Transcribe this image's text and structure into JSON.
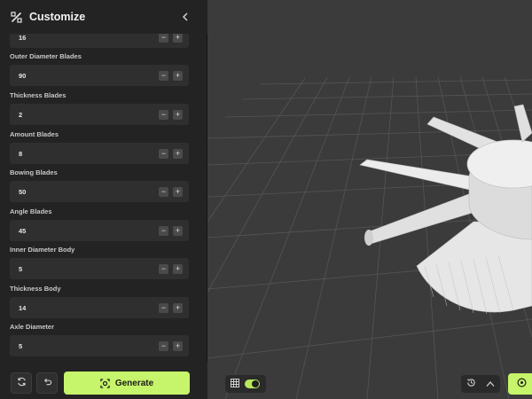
{
  "header": {
    "title": "Customize",
    "logo_icon": "magic-wand-icon",
    "collapse_icon": "chevron-left-icon"
  },
  "params": [
    {
      "label": "",
      "value": "16"
    },
    {
      "label": "Outer Diameter Blades",
      "value": "90"
    },
    {
      "label": "Thickness Blades",
      "value": "2"
    },
    {
      "label": "Amount Blades",
      "value": "8"
    },
    {
      "label": "Bowing Blades",
      "value": "50"
    },
    {
      "label": "Angle Blades",
      "value": "45"
    },
    {
      "label": "Inner Diameter Body",
      "value": "5"
    },
    {
      "label": "Thickness Body",
      "value": "14"
    },
    {
      "label": "Axle Diameter",
      "value": "5"
    }
  ],
  "stepper": {
    "minus": "−",
    "plus": "+"
  },
  "footer": {
    "reset_icon": "refresh-icon",
    "undo_icon": "undo-icon",
    "generate_label": "Generate",
    "generate_icon": "target-icon"
  },
  "viewport": {
    "grid_icon": "grid-icon",
    "grid_toggle_on": true,
    "history_icon": "history-icon",
    "expand_icon": "chevron-up-icon",
    "accent_color": "#c6f46a",
    "background_color": "#3b3b3b"
  }
}
